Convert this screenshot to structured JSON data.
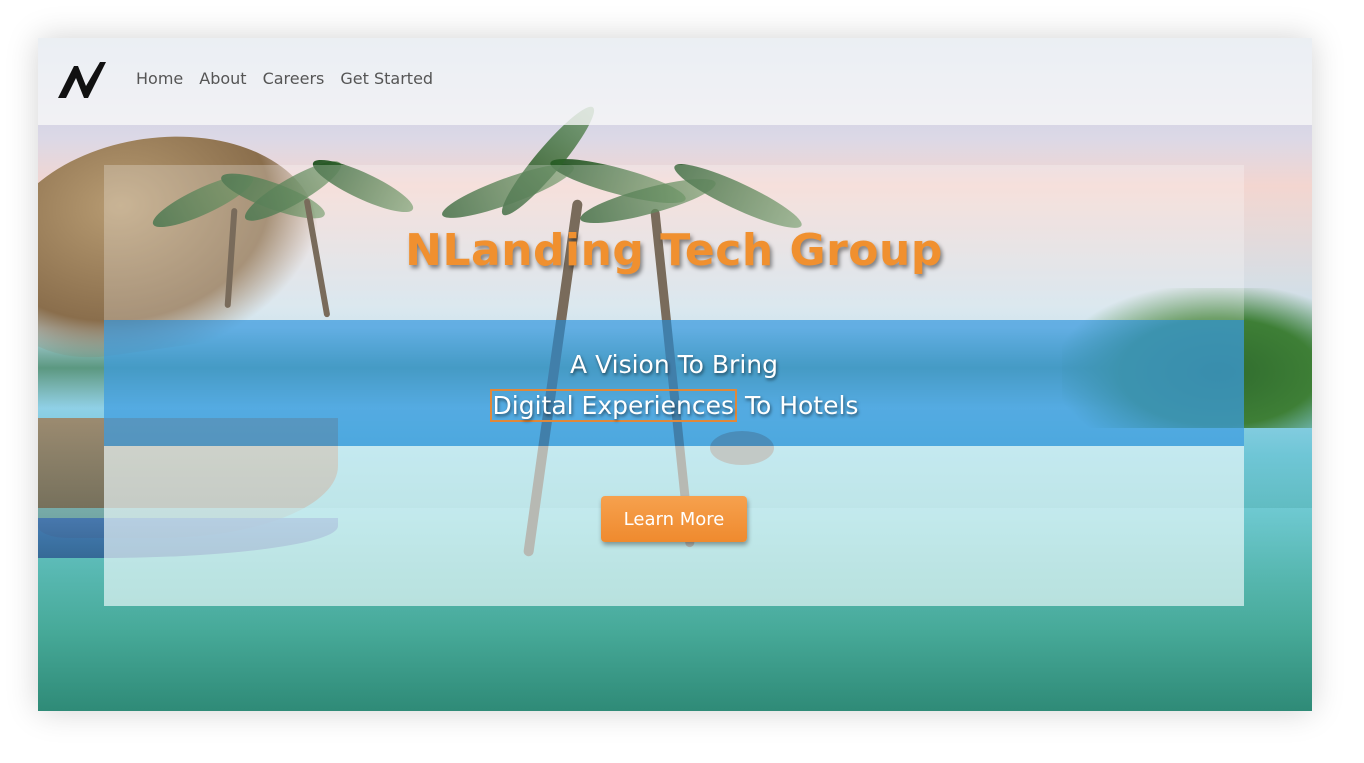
{
  "nav": {
    "logo_icon": "nlanding-logo-icon",
    "items": [
      {
        "label": "Home"
      },
      {
        "label": "About"
      },
      {
        "label": "Careers"
      },
      {
        "label": "Get Started"
      }
    ]
  },
  "hero": {
    "title": "NLanding Tech Group",
    "tagline_line1": "A Vision To Bring",
    "tagline_highlight": "Digital Experiences",
    "tagline_rest": " To Hotels",
    "cta_label": "Learn More"
  },
  "colors": {
    "accent": "#f0902f",
    "band": "#1e8cdc",
    "nav_text": "#555555"
  }
}
